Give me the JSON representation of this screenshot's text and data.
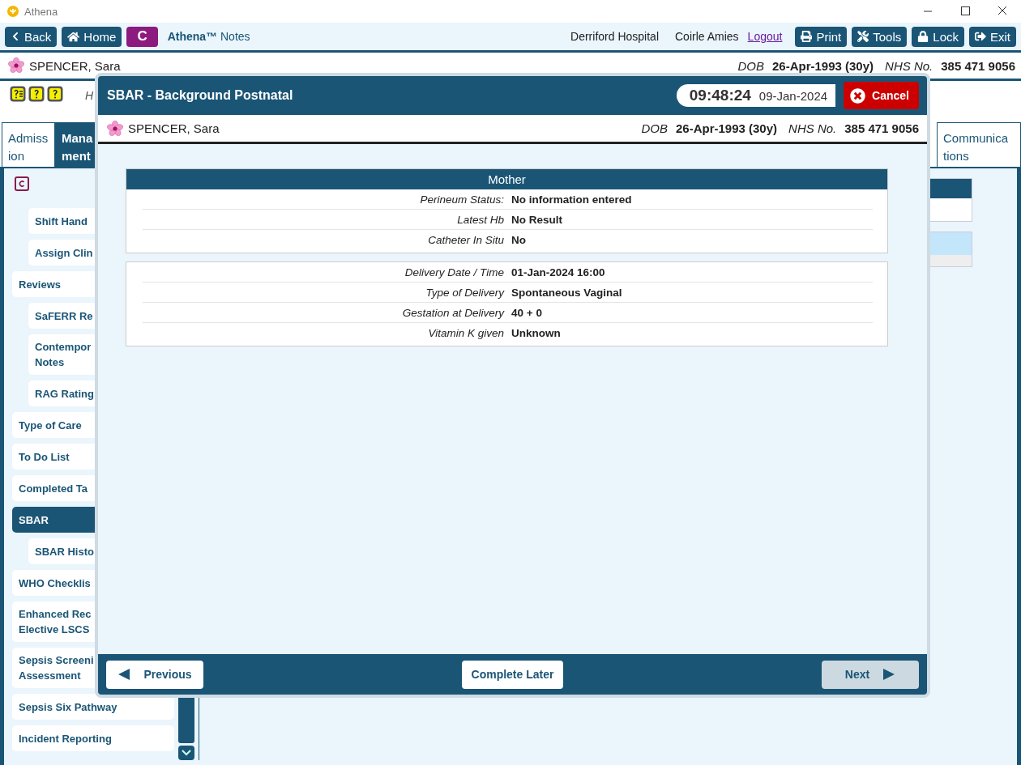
{
  "app": {
    "title": "Athena"
  },
  "toolbar": {
    "nav": [
      {
        "kind": "back",
        "label": "Back"
      },
      {
        "kind": "home",
        "label": "Home"
      },
      {
        "kind": "brand",
        "label": "C"
      }
    ],
    "app_name": "Athena™",
    "app_suffix": "Notes",
    "hospital": "Derriford Hospital",
    "user": "Coirle Amies",
    "logout": "Logout",
    "actions": [
      {
        "kind": "print",
        "label": "Print"
      },
      {
        "kind": "tools",
        "label": "Tools"
      },
      {
        "kind": "lock",
        "label": "Lock"
      },
      {
        "kind": "exit",
        "label": "Exit"
      }
    ]
  },
  "patient": {
    "name": "SPENCER, Sara",
    "dob_label": "DOB",
    "dob": "26-Apr-1993 (30y)",
    "nhs_label": "NHS No.",
    "nhs": "385 471 9056"
  },
  "hint": "H",
  "tabs_left": [
    {
      "label": "Admiss\nion",
      "selected": false
    },
    {
      "label": "Mana\nment",
      "selected": true
    }
  ],
  "tabs_right": [
    {
      "label": "Communica\ntions",
      "selected": false
    }
  ],
  "sidebar": {
    "items": [
      {
        "children": [
          {
            "label": "Shift Hand",
            "selected": false
          },
          {
            "label": "Assign Clin",
            "selected": false
          }
        ]
      },
      {
        "label": "Reviews",
        "selected": false,
        "children": [
          {
            "label": "SaFERR Re",
            "selected": false
          },
          {
            "label": "Contempor\nNotes",
            "selected": false
          },
          {
            "label": "RAG Rating",
            "selected": false
          }
        ]
      },
      {
        "label": "Type of Care",
        "selected": false
      },
      {
        "label": "To Do List",
        "selected": false
      },
      {
        "label": "Completed Ta",
        "selected": false
      },
      {
        "label": "SBAR",
        "selected": true,
        "children": [
          {
            "label": "SBAR Histo",
            "selected": false
          }
        ]
      },
      {
        "label": "WHO Checklis",
        "selected": false
      },
      {
        "label": "Enhanced Rec\nElective LSCS",
        "selected": false
      },
      {
        "label": "Sepsis Screeni\nAssessment",
        "selected": false
      },
      {
        "label": "Sepsis Six Pathway",
        "selected": false
      },
      {
        "label": "Incident Reporting",
        "selected": false
      }
    ]
  },
  "modal": {
    "title": "SBAR - Background Postnatal",
    "time": "09:48:24",
    "date": "09-Jan-2024",
    "cancel": "Cancel",
    "patient": {
      "name": "SPENCER, Sara",
      "dob_label": "DOB",
      "dob": "26-Apr-1993 (30y)",
      "nhs_label": "NHS No.",
      "nhs": "385 471 9056"
    },
    "sections": [
      {
        "title": "Mother",
        "rows": [
          {
            "label": "Perineum Status:",
            "value": "No information entered"
          },
          {
            "label": "Latest Hb",
            "value": "No Result"
          },
          {
            "label": "Catheter In Situ",
            "value": "No"
          }
        ]
      },
      {
        "rows": [
          {
            "label": "Delivery Date / Time",
            "value": "01-Jan-2024 16:00"
          },
          {
            "label": "Type of Delivery",
            "value": "Spontaneous Vaginal"
          },
          {
            "label": "Gestation at Delivery",
            "value": "40 + 0"
          },
          {
            "label": "Vitamin K given",
            "value": "Unknown"
          }
        ]
      }
    ],
    "footer": {
      "previous": {
        "label": "Previous",
        "disabled": false
      },
      "complete_later": "Complete Later",
      "next": {
        "label": "Next",
        "disabled": true
      }
    }
  }
}
